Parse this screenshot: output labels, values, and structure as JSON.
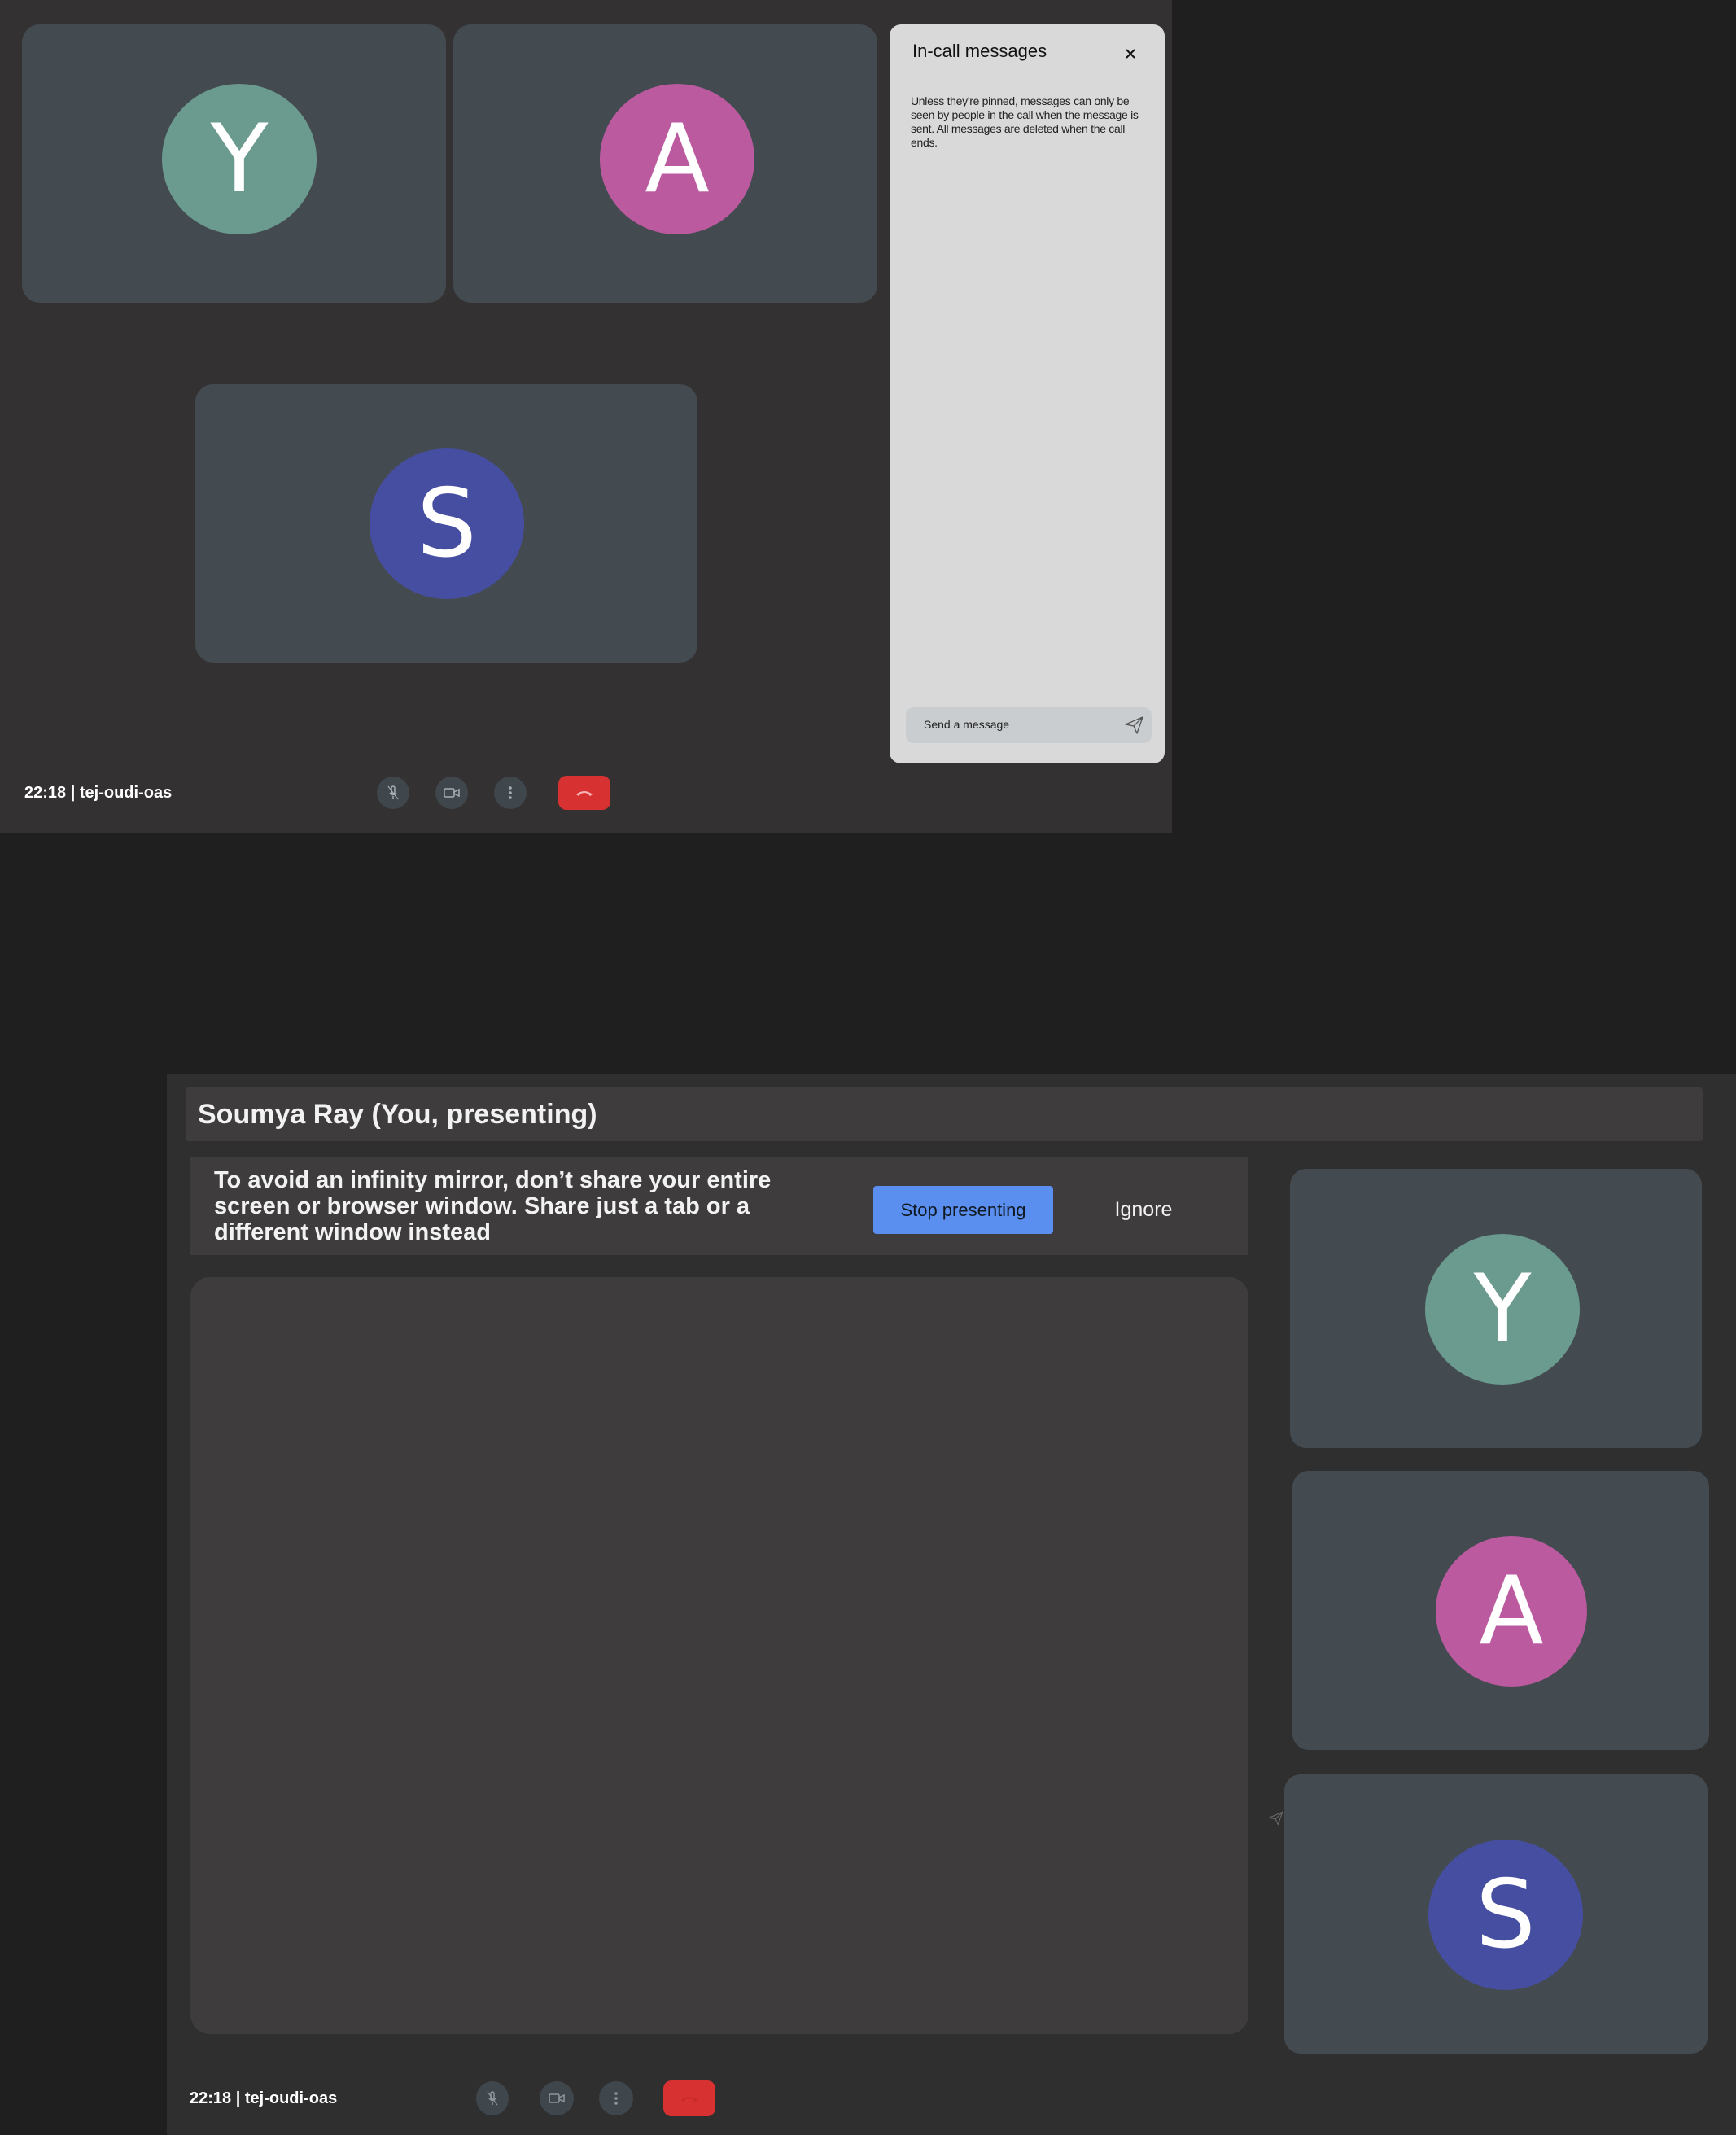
{
  "grid_view": {
    "participants": [
      {
        "initial": "Y",
        "color": "#6b9a8f"
      },
      {
        "initial": "A",
        "color": "#bc5aa0"
      },
      {
        "initial": "S",
        "color": "#464ea1"
      }
    ],
    "meeting_info": "22:18 | tej-oudi-oas",
    "controls": {
      "mic_icon": "mic-off-icon",
      "camera_icon": "camera-off-icon",
      "more_icon": "more-vert-icon",
      "hangup_icon": "phone-hangup-icon"
    }
  },
  "chat_panel": {
    "title": "In-call messages",
    "notice": "Unless they're pinned, messages can only be seen by people in the call when the message is sent. All messages are deleted when the call ends.",
    "input_placeholder": "Send a message"
  },
  "presenting_view": {
    "presenter_label": "Soumya Ray (You, presenting)",
    "warning_text": "To avoid an infinity mirror, don’t share your entire screen or browser window. Share just a tab or a different window instead",
    "stop_button": "Stop presenting",
    "ignore_button": "Ignore",
    "participants": [
      {
        "initial": "Y",
        "color": "#6b9a8f"
      },
      {
        "initial": "A",
        "color": "#bc5aa0"
      },
      {
        "initial": "S",
        "color": "#464ea1"
      }
    ],
    "meeting_info": "22:18 | tej-oudi-oas"
  },
  "colors": {
    "hangup": "#d83131",
    "accent_button": "#5a8ff0"
  }
}
